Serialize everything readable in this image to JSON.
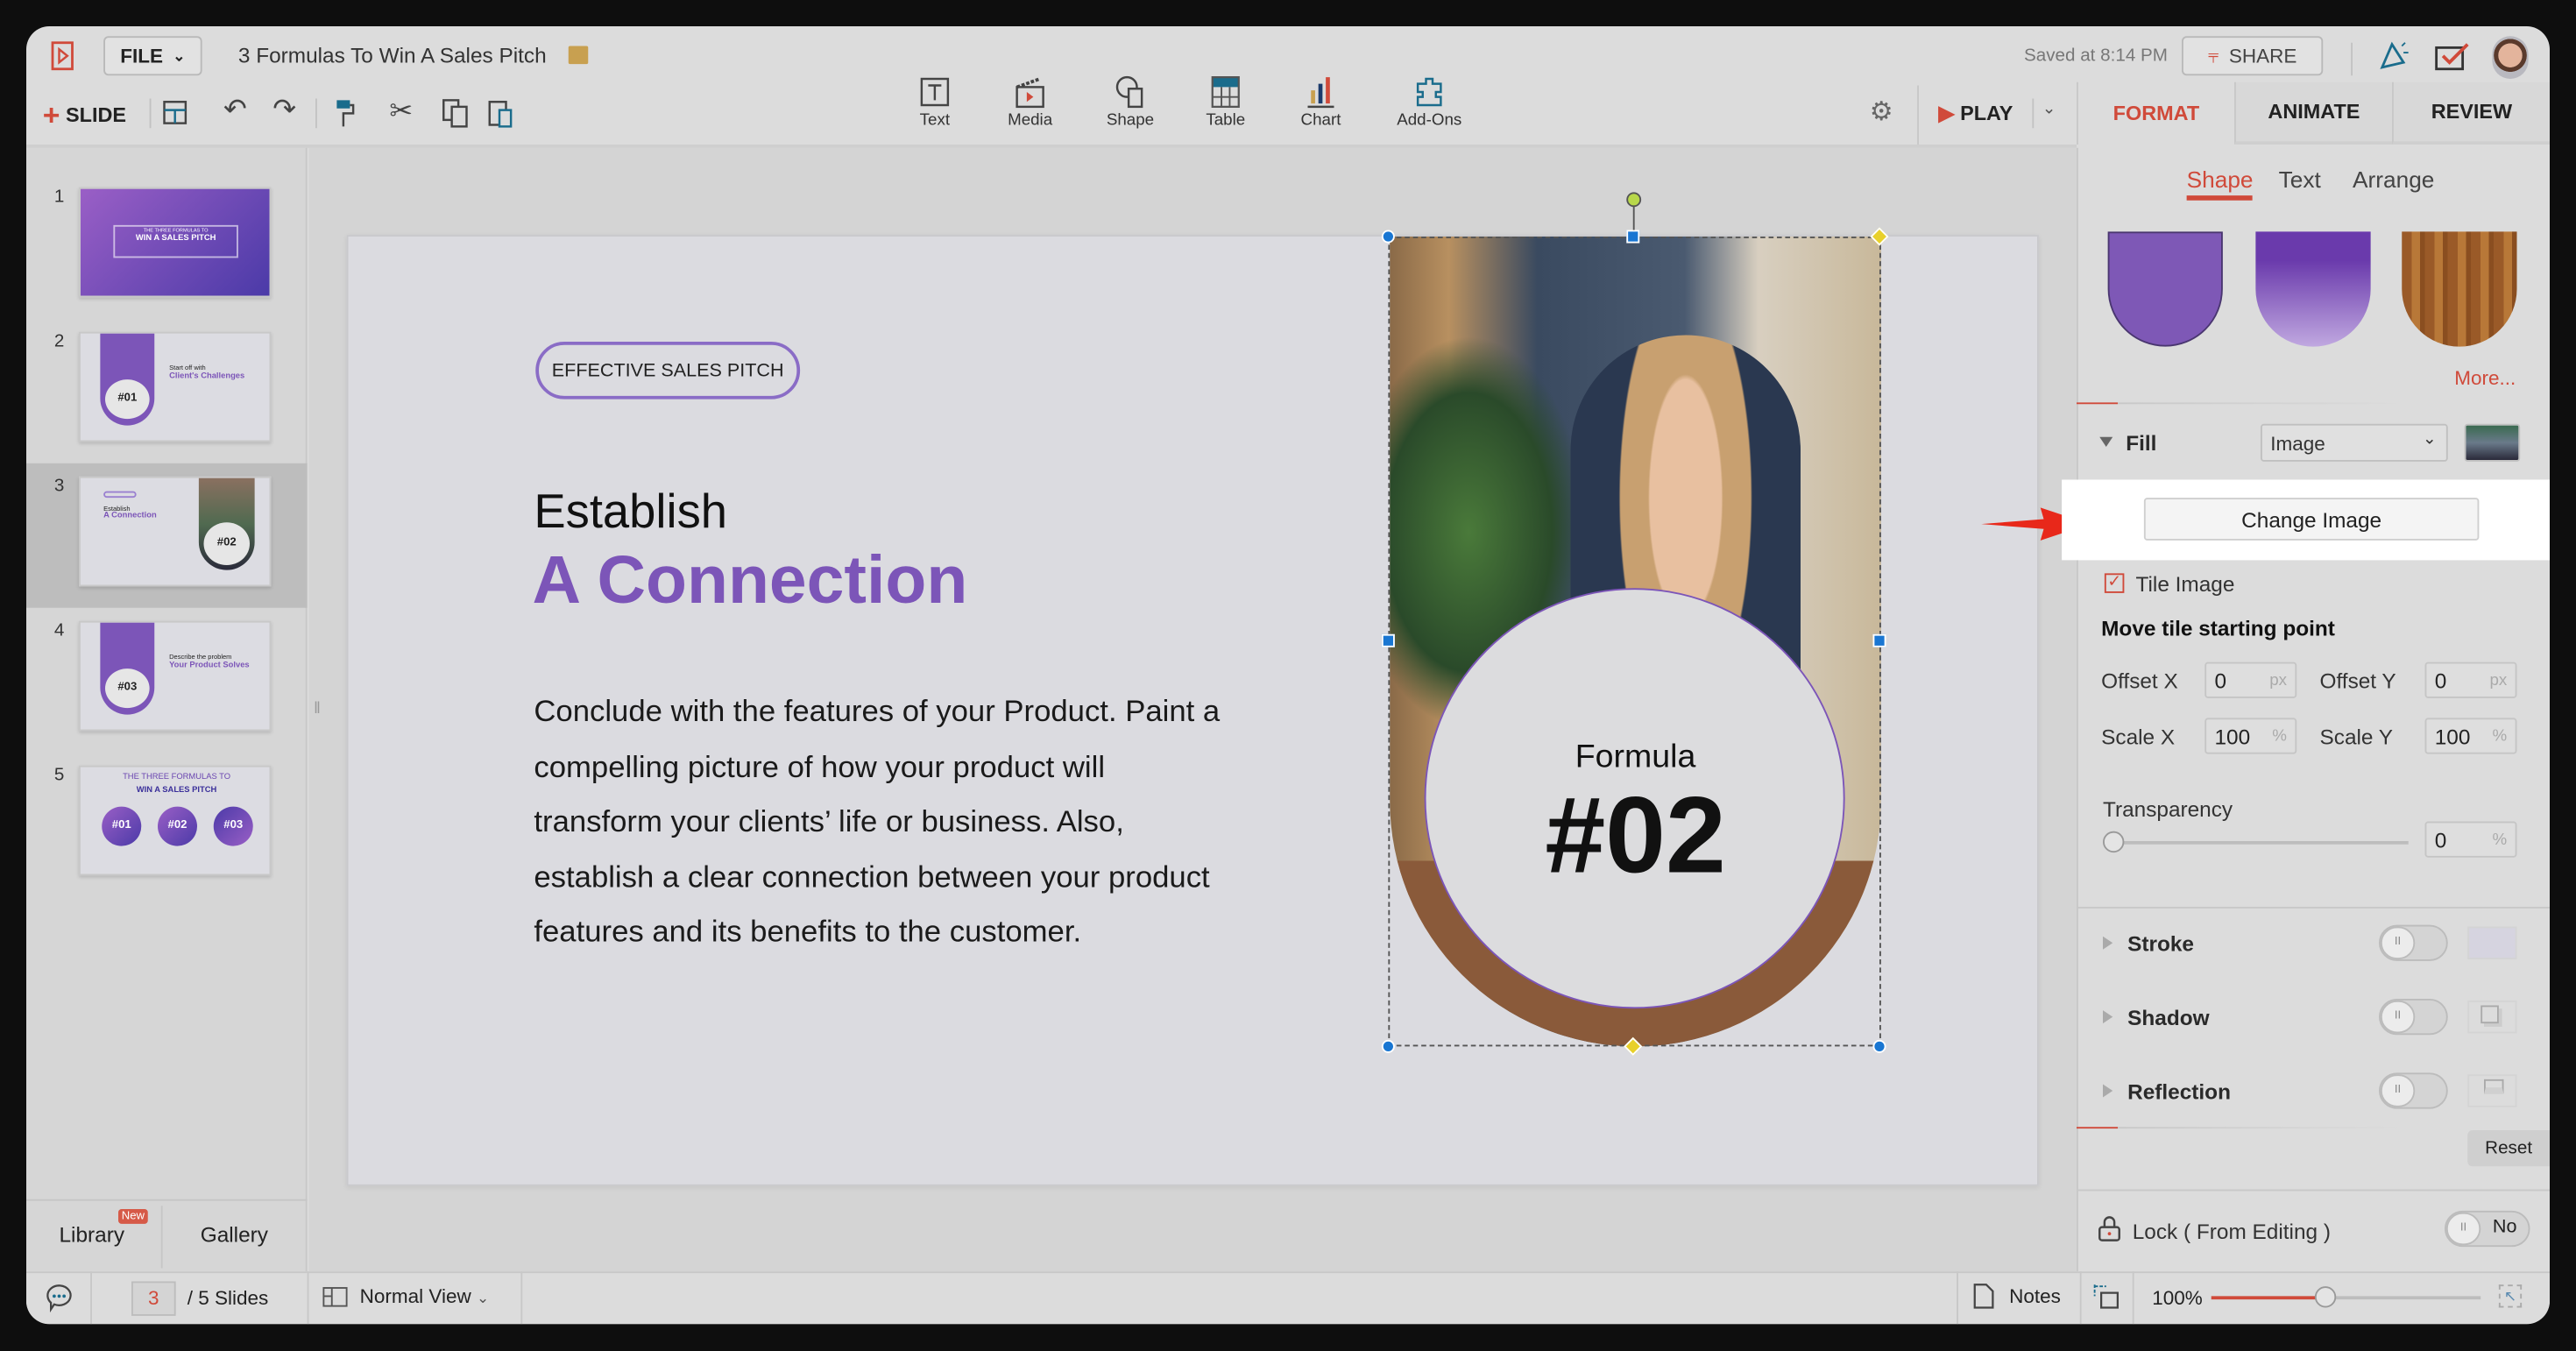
{
  "app": {
    "file_menu": "FILE",
    "doc_title": "3 Formulas To Win A Sales Pitch",
    "saved_status": "Saved at 8:14 PM",
    "share": "SHARE",
    "accent": "#d04a3a",
    "brand_purple": "#7c55b8"
  },
  "toolbar": {
    "slide": "SLIDE",
    "insert": [
      {
        "label": "Text",
        "icon": "text-box-icon"
      },
      {
        "label": "Media",
        "icon": "clapper-icon"
      },
      {
        "label": "Shape",
        "icon": "shape-icon"
      },
      {
        "label": "Table",
        "icon": "table-icon"
      },
      {
        "label": "Chart",
        "icon": "bar-chart-icon"
      },
      {
        "label": "Add-Ons",
        "icon": "puzzle-icon"
      }
    ],
    "play": "PLAY"
  },
  "right_tabs": [
    "FORMAT",
    "ANIMATE",
    "REVIEW"
  ],
  "sidebar": {
    "slides": [
      {
        "n": "1",
        "kicker": "THE THREE FORMULAS TO",
        "title": "WIN A SALES PITCH"
      },
      {
        "n": "2",
        "pre": "Start off with",
        "title": "Client's Challenges",
        "badge": "#01"
      },
      {
        "n": "3",
        "pre": "Establish",
        "title": "A Connection",
        "badge": "#02"
      },
      {
        "n": "4",
        "pre": "Describe the problem",
        "title": "Your Product Solves",
        "badge": "#03"
      },
      {
        "n": "5",
        "kicker": "THE THREE FORMULAS TO",
        "title": "WIN A SALES PITCH",
        "badges": [
          "#01",
          "#02",
          "#03"
        ]
      }
    ],
    "selected": "3",
    "library": "Library",
    "library_badge": "New",
    "gallery": "Gallery"
  },
  "slide": {
    "pill": "EFFECTIVE SALES PITCH",
    "heading1": "Establish",
    "heading2": "A Connection",
    "body": [
      "Conclude with the features of your Product. Paint a",
      "compelling picture of how your product will",
      "transform your clients’ life or business. Also,",
      "establish a clear connection between your product",
      "features and its benefits to the customer."
    ],
    "formula_label": "Formula",
    "formula_num": "#02"
  },
  "format": {
    "subtabs": [
      "Shape",
      "Text",
      "Arrange"
    ],
    "active_subtab": "Shape",
    "more": "More...",
    "fill_label": "Fill",
    "fill_type": "Image",
    "change_image": "Change Image",
    "tile_image": "Tile Image",
    "tile_checked": true,
    "move_tile": "Move tile starting point",
    "offset_x_label": "Offset X",
    "offset_x": "0",
    "offset_y_label": "Offset Y",
    "offset_y": "0",
    "px": "px",
    "scale_x_label": "Scale X",
    "scale_x": "100",
    "scale_y_label": "Scale Y",
    "scale_y": "100",
    "pct": "%",
    "transparency_label": "Transparency",
    "transparency": "0",
    "stroke": "Stroke",
    "shadow": "Shadow",
    "reflection": "Reflection",
    "reset": "Reset",
    "lock": "Lock ( From Editing )",
    "lock_value": "No"
  },
  "status": {
    "current_slide": "3",
    "total": "/ 5 Slides",
    "view": "Normal View",
    "notes": "Notes",
    "zoom": "100%",
    "zoom_value": 100
  }
}
